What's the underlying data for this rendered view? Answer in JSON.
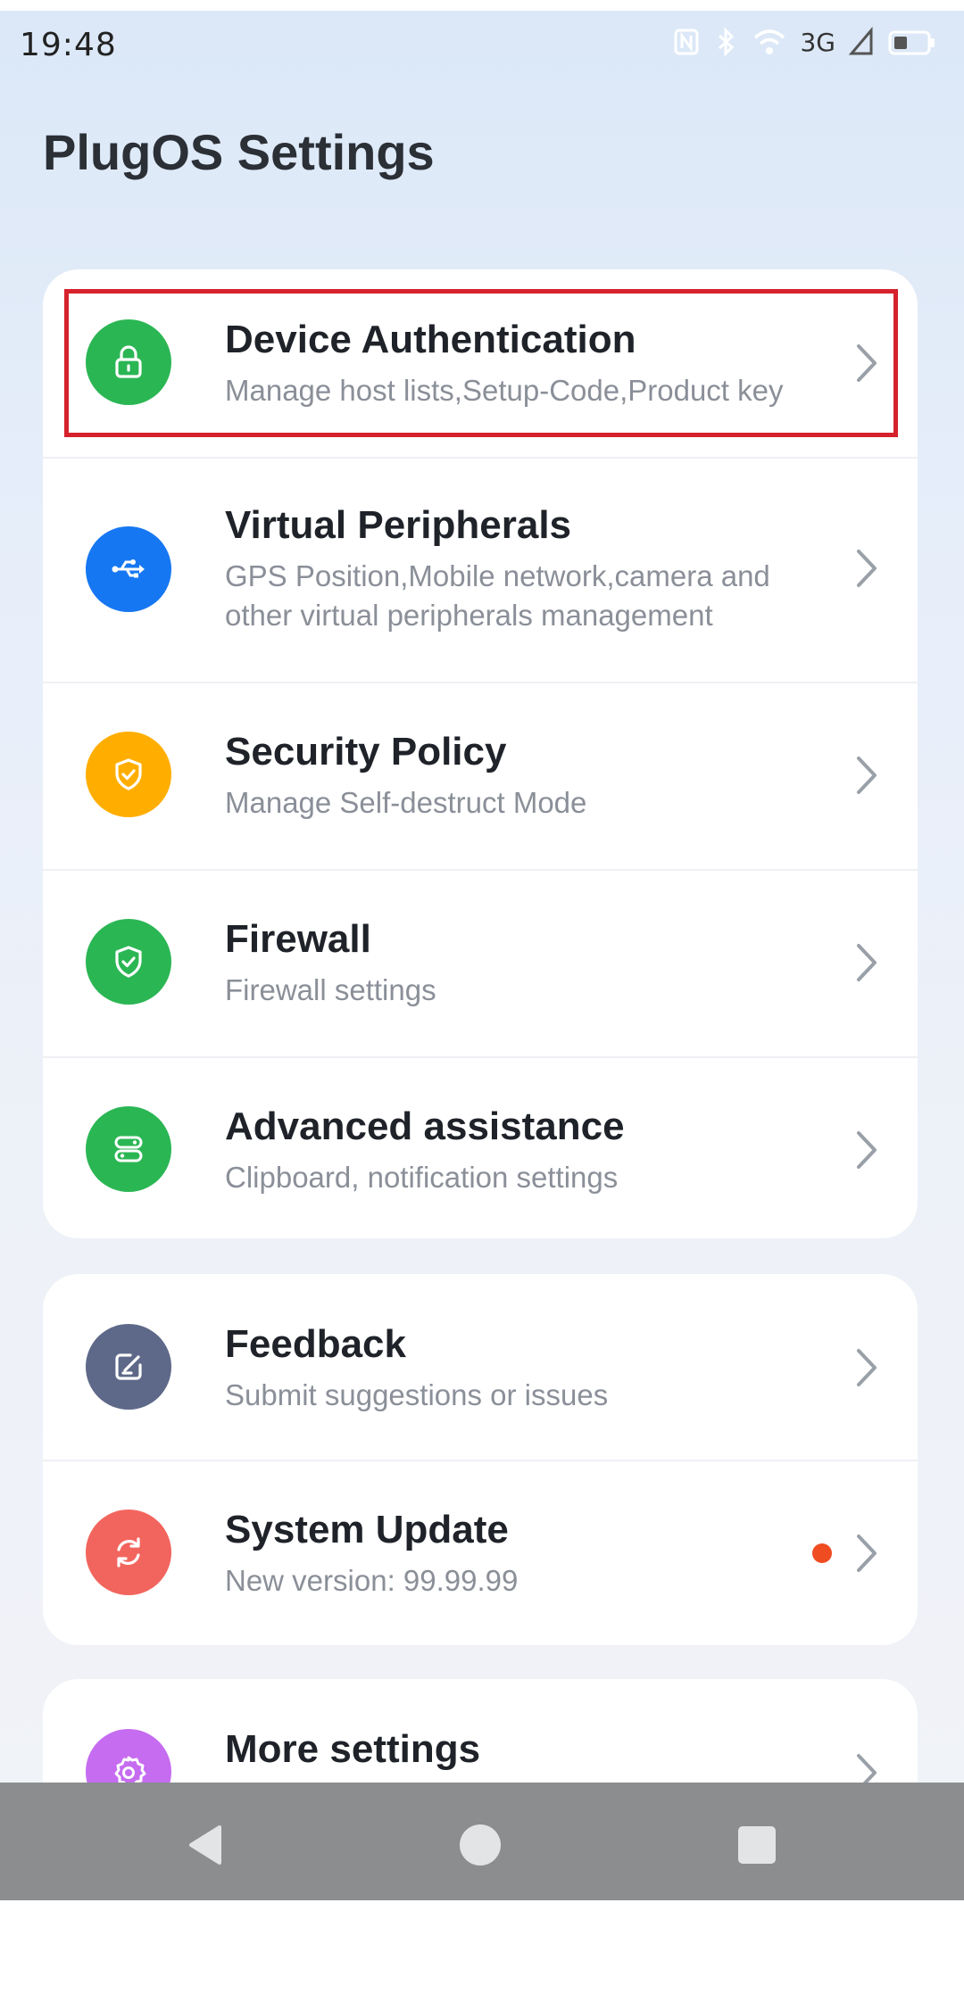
{
  "status_bar": {
    "time": "19:48",
    "network": "3G"
  },
  "title": "PlugOS Settings",
  "groups": [
    {
      "items": [
        {
          "title": "Device Authentication",
          "subtitle": "Manage host lists,Setup-Code,Product key",
          "icon": "lock-icon",
          "color": "#2bb654"
        },
        {
          "title": "Virtual Peripherals",
          "subtitle": "GPS Position,Mobile network,camera and other virtual peripherals management",
          "icon": "usb-icon",
          "color": "#1677f2"
        },
        {
          "title": "Security Policy",
          "subtitle": "Manage Self-destruct Mode",
          "icon": "shield-check-icon",
          "color": "#ffae00"
        },
        {
          "title": "Firewall",
          "subtitle": "Firewall settings",
          "icon": "shield-check-icon",
          "color": "#2bb654"
        },
        {
          "title": "Advanced assistance",
          "subtitle": "Clipboard, notification settings",
          "icon": "toggle-stack-icon",
          "color": "#2bb654"
        }
      ]
    },
    {
      "items": [
        {
          "title": "Feedback",
          "subtitle": "Submit suggestions or issues",
          "icon": "edit-icon",
          "color": "#5e6989"
        },
        {
          "title": "System Update",
          "subtitle": "New version: 99.99.99",
          "icon": "refresh-icon",
          "color": "#f2655e",
          "badge": true
        }
      ]
    },
    {
      "items": [
        {
          "title": "More settings",
          "subtitle": "",
          "icon": "gear-icon",
          "color": "#c56cf0"
        }
      ]
    }
  ],
  "colors": {
    "highlight_border": "#d6222c",
    "badge": "#f04c22",
    "nav_bar": "#8b8d8f"
  }
}
